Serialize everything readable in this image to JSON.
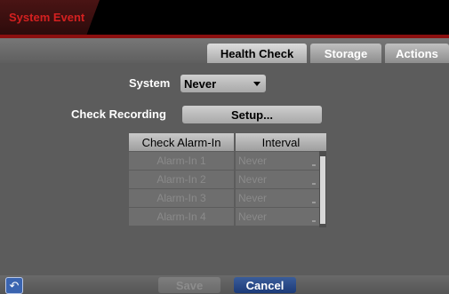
{
  "window": {
    "title": "System Event"
  },
  "tabs": [
    {
      "label": "Health Check",
      "active": true
    },
    {
      "label": "Storage",
      "active": false
    },
    {
      "label": "Actions",
      "active": false
    }
  ],
  "form": {
    "system_label": "System",
    "system_value": "Never",
    "check_recording_label": "Check Recording",
    "setup_label": "Setup..."
  },
  "table": {
    "headers": [
      "Check Alarm-In",
      "Interval"
    ],
    "rows": [
      {
        "alarm": "Alarm-In 1",
        "interval": "Never"
      },
      {
        "alarm": "Alarm-In 2",
        "interval": "Never"
      },
      {
        "alarm": "Alarm-In 3",
        "interval": "Never"
      },
      {
        "alarm": "Alarm-In 4",
        "interval": "Never"
      }
    ]
  },
  "footer": {
    "back_icon": "back-arrow-icon",
    "save_label": "Save",
    "cancel_label": "Cancel"
  },
  "colors": {
    "accent": "#d42020",
    "cancel": "#1c3a78"
  }
}
